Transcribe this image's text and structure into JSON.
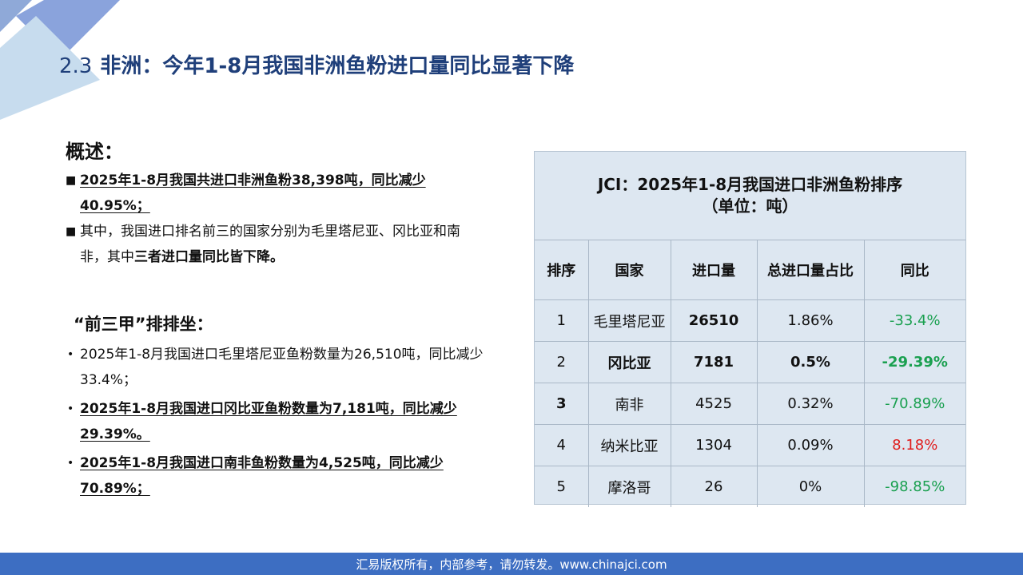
{
  "title": {
    "number": "2.3",
    "text": "非洲：今年1-8月我国非洲鱼粉进口量同比显著下降"
  },
  "summary": {
    "heading": "概述：",
    "item1": "2025年1-8月我国共进口非洲鱼粉38,398吨，同比减少40.95%；",
    "item2_part1": "其中，我国进口排名前三的国家分别为毛里塔尼亚、冈比亚和南非，其中",
    "item2_part2": "三者进口量同比皆下降。"
  },
  "top3": {
    "heading": "“前三甲”排排坐：",
    "items": [
      "2025年1-8月我国进口毛里塔尼亚鱼粉数量为26,510吨，同比减少33.4%；",
      "2025年1-8月我国进口冈比亚鱼粉数量为7,181吨，同比减少29.39%。",
      "2025年1-8月我国进口南非鱼粉数量为4,525吨，同比减少70.89%；"
    ]
  },
  "table": {
    "title_line1": "JCI：2025年1-8月我国进口非洲鱼粉排序",
    "title_line2": "（单位：吨）",
    "headers": [
      "排序",
      "国家",
      "进口量",
      "总进口量占比",
      "同比"
    ],
    "rows": [
      {
        "rank": "1",
        "country": "毛里塔尼亚",
        "volume": "26510",
        "share": "1.86%",
        "yoy": "-33.4%"
      },
      {
        "rank": "2",
        "country": "冈比亚",
        "volume": "7181",
        "share": "0.5%",
        "yoy": "-29.39%"
      },
      {
        "rank": "3",
        "country": "南非",
        "volume": "4525",
        "share": "0.32%",
        "yoy": "-70.89%"
      },
      {
        "rank": "4",
        "country": "纳米比亚",
        "volume": "1304",
        "share": "0.09%",
        "yoy": "8.18%"
      },
      {
        "rank": "5",
        "country": "摩洛哥",
        "volume": "26",
        "share": "0%",
        "yoy": "-98.85%"
      }
    ]
  },
  "colors": {
    "title": "#1f3f7a",
    "footer_bg": "#3d6ec2",
    "table_bg": "#dde7f1",
    "negative": "#1aa050",
    "positive": "#e01c1c"
  },
  "footer": {
    "text": "汇易版权所有，内部参考，请勿转发。www.chinajci.com"
  }
}
